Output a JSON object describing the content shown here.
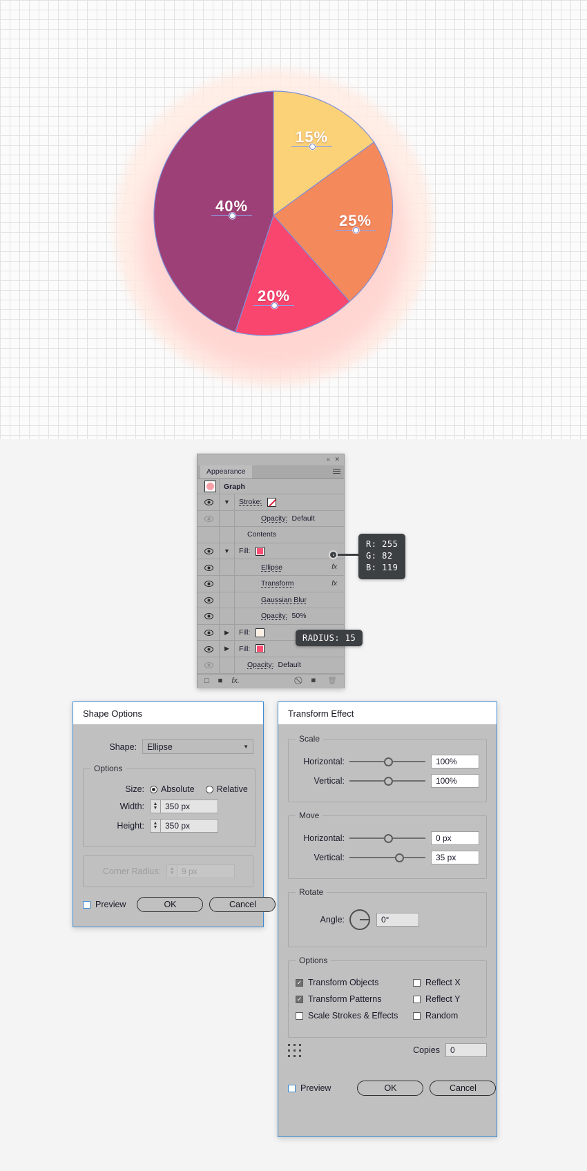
{
  "chart_data": {
    "type": "pie",
    "title": "",
    "categories": [
      "40%",
      "15%",
      "25%",
      "20%"
    ],
    "values": [
      40,
      15,
      25,
      20
    ],
    "labels": [
      "40%",
      "15%",
      "25%",
      "20%"
    ],
    "colors": [
      "#9e4078",
      "#fbd277",
      "#f4895c",
      "#f9466f"
    ],
    "legend": "none",
    "annotations": [
      "40%",
      "15%",
      "25%",
      "20%"
    ]
  },
  "canvas": {
    "slices": [
      {
        "label": "40%",
        "value": 40,
        "color": "#9e4078"
      },
      {
        "label": "15%",
        "value": 15,
        "color": "#fbd277"
      },
      {
        "label": "25%",
        "value": 25,
        "color": "#f4895c"
      },
      {
        "label": "20%",
        "value": 20,
        "color": "#f9466f"
      }
    ]
  },
  "appearance": {
    "tab_label": "Appearance",
    "rows": [
      {
        "label": "Graph",
        "type": "target"
      },
      {
        "label": "Stroke:",
        "type": "stroke"
      },
      {
        "label": "Opacity:",
        "value": "Default",
        "type": "opacity"
      },
      {
        "label": "Contents",
        "type": "section"
      },
      {
        "label": "Fill:",
        "type": "fill",
        "color": "#fa4f72"
      },
      {
        "label": "Ellipse",
        "type": "effect",
        "fx": "fx"
      },
      {
        "label": "Transform",
        "type": "effect",
        "fx": "fx"
      },
      {
        "label": "Gaussian Blur",
        "type": "effect"
      },
      {
        "label": "Opacity:",
        "value": "50%",
        "type": "opacity"
      },
      {
        "label": "Fill:",
        "type": "fill",
        "color": "#fdefe2"
      },
      {
        "label": "Fill:",
        "type": "fill",
        "color": "#fa4f72"
      },
      {
        "label": "Opacity:",
        "value": "Default",
        "type": "opacity"
      }
    ]
  },
  "tooltips": {
    "rgb": {
      "r": "R: 255",
      "g": "G: 82",
      "b": "B: 119"
    },
    "radius": "RADIUS: 15"
  },
  "shape_options": {
    "title": "Shape Options",
    "shape_label": "Shape:",
    "shape_value": "Ellipse",
    "options_legend": "Options",
    "size_label": "Size:",
    "absolute_label": "Absolute",
    "relative_label": "Relative",
    "width_label": "Width:",
    "width_value": "350 px",
    "height_label": "Height:",
    "height_value": "350 px",
    "corner_radius_label": "Corner Radius:",
    "corner_radius_value": "9 px",
    "preview_label": "Preview",
    "ok_label": "OK",
    "cancel_label": "Cancel"
  },
  "transform_effect": {
    "title": "Transform Effect",
    "scale_legend": "Scale",
    "scale_h_label": "Horizontal:",
    "scale_h_value": "100%",
    "scale_v_label": "Vertical:",
    "scale_v_value": "100%",
    "move_legend": "Move",
    "move_h_label": "Horizontal:",
    "move_h_value": "0 px",
    "move_v_label": "Vertical:",
    "move_v_value": "35 px",
    "rotate_legend": "Rotate",
    "angle_label": "Angle:",
    "angle_value": "0°",
    "options_legend": "Options",
    "transform_objects": "Transform Objects",
    "transform_patterns": "Transform Patterns",
    "scale_strokes": "Scale Strokes & Effects",
    "reflect_x": "Reflect X",
    "reflect_y": "Reflect Y",
    "random": "Random",
    "copies_label": "Copies",
    "copies_value": "0",
    "preview_label": "Preview",
    "ok_label": "OK",
    "cancel_label": "Cancel"
  }
}
